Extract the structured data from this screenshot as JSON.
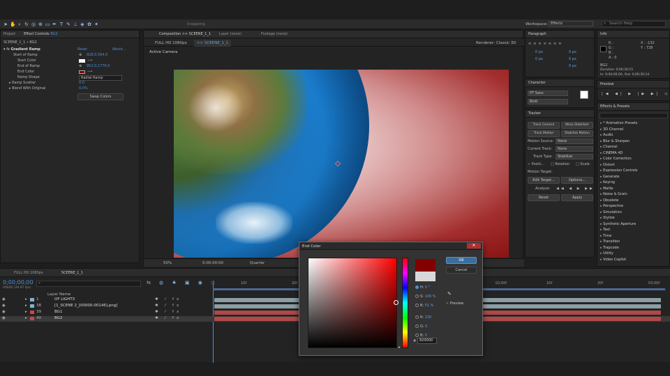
{
  "toolbar": {
    "snapping": "Snapping",
    "workspace_label": "Workspace:",
    "workspace_value": "Effects",
    "search_placeholder": "Search Help"
  },
  "project_panel": {
    "tab_project": "Project",
    "tab_effect_controls": "Effect Controls",
    "effect_layer": "BG2",
    "breadcrumb": "SCEENE_1_1 • BG2",
    "effect_name": "Gradient Ramp",
    "reset": "Reset",
    "about": "About...",
    "props": [
      {
        "name": "Start of Ramp",
        "value": "928.0,564.0"
      },
      {
        "name": "Start Color",
        "value": ""
      },
      {
        "name": "End of Ramp",
        "value": "952.0,1776.0"
      },
      {
        "name": "End Color",
        "value": ""
      },
      {
        "name": "Ramp Shape",
        "value": "Radial Ramp"
      },
      {
        "name": "Ramp Scatter",
        "value": "0.0"
      },
      {
        "name": "Blend With Original",
        "value": "0.0%"
      }
    ],
    "swap_button": "Swap Colors"
  },
  "comp_panel": {
    "tab_comp": "Composition >> SCEENE_1_1",
    "tab_layer": "Layer (none)",
    "tab_footage": "Footage (none)",
    "sub_tab1": "FULL HD 1080px",
    "sub_tab2": ">> SCEENE_1_1",
    "renderer_label": "Renderer:",
    "renderer_value": "Classic 3D",
    "active_camera": "Active Camera",
    "zoom": "50%",
    "timecode": "0:00:00:00",
    "quality": "Quarter"
  },
  "paragraph_panel": {
    "title": "Paragraph",
    "values": [
      "0 px",
      "0 px",
      "0 px",
      "0 px",
      "0 px"
    ]
  },
  "character_panel": {
    "title": "Character",
    "font": "PT Sans",
    "style": "Bold"
  },
  "tracker_panel": {
    "title": "Tracker",
    "track_camera": "Track Camera",
    "warp_stabilizer": "Warp Stabilizer",
    "track_motion": "Track Motion",
    "stabilize_motion": "Stabilize Motion",
    "motion_source_label": "Motion Source:",
    "motion_source": "None",
    "current_track_label": "Current Track:",
    "current_track": "None",
    "track_type_label": "Track Type:",
    "track_type": "Stabilize",
    "position": "Positi...",
    "rotation": "Rotation",
    "scale": "Scale",
    "motion_target": "Motion Target:",
    "edit_target": "Edit Target...",
    "options": "Options...",
    "analyze": "Analyze:",
    "reset": "Reset",
    "apply": "Apply"
  },
  "info_panel": {
    "title": "Info",
    "r": "R :",
    "g": "G :",
    "b": "B :",
    "a": "A : 0",
    "x": "X : -132",
    "y": "Y : 728",
    "layer": "BG2",
    "duration": "Duration: 0;00;30;15",
    "in_out": "In: 0;00;00;00, Out: 0;00;30;14"
  },
  "preview_panel": {
    "title": "Preview"
  },
  "effects_panel": {
    "title": "Effects & Presets",
    "items": [
      "* Animation Presets",
      "3D Channel",
      "Audio",
      "Blur & Sharpen",
      "Channel",
      "CINEMA 4D",
      "Color Correction",
      "Distort",
      "Expression Controls",
      "Generate",
      "Keying",
      "Matte",
      "Noise & Grain",
      "Obsolete",
      "Perspective",
      "Simulation",
      "Stylize",
      "Synthetic Aperture",
      "Text",
      "Time",
      "Transition",
      "Trapcode",
      "Utility",
      "Video Copilot"
    ]
  },
  "timeline": {
    "tab1": "FULL HD 1080px",
    "tab2": "SCEENE_1_1",
    "timecode": "0;00;00;00",
    "fps": "00000 (29.97 fps)",
    "layer_name_header": "Layer Name",
    "ruler": [
      "10f",
      "20f",
      "01;00f",
      "10f",
      "20f",
      "02;00f",
      "10f",
      "20f",
      "03;00f"
    ],
    "layers": [
      {
        "num": "1",
        "name": "OF LIGHT3"
      },
      {
        "num": "38",
        "name": "[1_SCENE 2_[00000-00146].png]"
      },
      {
        "num": "39",
        "name": "BG1"
      },
      {
        "num": "40",
        "name": "BG2"
      }
    ]
  },
  "dialog": {
    "title": "End Color",
    "ok": "OK",
    "cancel": "Cancel",
    "preview": "Preview",
    "fields": [
      {
        "label": "H:",
        "value": "0 °"
      },
      {
        "label": "S:",
        "value": "100 %"
      },
      {
        "label": "B:",
        "value": "51 %"
      },
      {
        "label": "R:",
        "value": "130"
      },
      {
        "label": "G:",
        "value": "0"
      },
      {
        "label": "B:",
        "value": "0"
      }
    ],
    "hex_label": "#",
    "hex": "820000"
  },
  "colors": {
    "end_color": "#820000",
    "start_color": "#ffffff",
    "accent": "#4a90d9"
  }
}
